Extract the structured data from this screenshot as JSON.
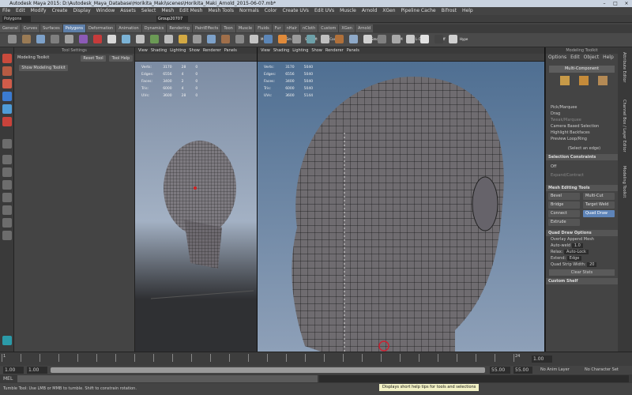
{
  "title": "Autodesk Maya 2015: D:\\Autodesk_Maya_Database\\Horikita_Maki\\scenes\\Horikita_Maki_Arnold_2015-06-07.mb*",
  "window_controls": [
    "–",
    "□",
    "×"
  ],
  "menus": [
    "File",
    "Edit",
    "Modify",
    "Create",
    "Display",
    "Window",
    "Assets",
    "Select",
    "Mesh",
    "Edit Mesh",
    "Mesh Tools",
    "Normals",
    "Color",
    "Create UVs",
    "Edit UVs",
    "Muscle",
    "Arnold",
    "XGen",
    "Pipeline Cache",
    "Bifrost",
    "Help"
  ],
  "status": {
    "mode": "Polygons",
    "selection_field": "Group20707"
  },
  "shelf_tabs": [
    "General",
    "Curves",
    "Surfaces",
    "Polygons",
    "Deformation",
    "Animation",
    "Dynamics",
    "Rendering",
    "PaintEffects",
    "Toon",
    "Muscle",
    "Fluids",
    "Fur",
    "nHair",
    "nCloth",
    "Custom",
    "XGen",
    "Arnold"
  ],
  "active_shelf_tab": "Polygons",
  "shelf_labels": [
    "M-Dm",
    "N-Sm",
    "Sm-Soft",
    "+Coord",
    "Pol-Fl",
    "Smos",
    "Del-M",
    "L-Off",
    "L-Off",
    "Hype"
  ],
  "tool_settings": {
    "header": "Tool Settings",
    "tool_name": "Modeling Toolkit",
    "reset_btn": "Reset Tool",
    "help_btn": "Tool Help",
    "show_btn": "Show Modeling Toolkit"
  },
  "viewport_menu": [
    "View",
    "Shading",
    "Lighting",
    "Show",
    "Renderer",
    "Panels"
  ],
  "stats_rows": [
    {
      "label": "Verts:",
      "a": "3170",
      "b": "28",
      "c": "0"
    },
    {
      "label": "Edges:",
      "a": "6556",
      "b": "4",
      "c": "0"
    },
    {
      "label": "Faces:",
      "a": "3400",
      "b": "2",
      "c": "0"
    },
    {
      "label": "Tris:",
      "a": "6000",
      "b": "4",
      "c": "0"
    },
    {
      "label": "UVs:",
      "a": "3600",
      "b": "28",
      "c": "0"
    }
  ],
  "stats_rows_right": [
    {
      "label": "Verts:",
      "a": "3170",
      "b": "5040"
    },
    {
      "label": "Edges:",
      "a": "6556",
      "b": "5040"
    },
    {
      "label": "Faces:",
      "a": "3400",
      "b": "5040"
    },
    {
      "label": "Tris:",
      "a": "6000",
      "b": "5040"
    },
    {
      "label": "UVs:",
      "a": "3600",
      "b": "5144"
    }
  ],
  "right_panel": {
    "header": "Modeling Toolkit",
    "menu": [
      "Options",
      "Edit",
      "Object",
      "Help"
    ],
    "multi_component": "Multi-Component",
    "pick_marquee": "Pick/Marquee",
    "drag": "Drag",
    "tweak": "Tweak/Marquee",
    "camera_sel": "Camera Based Selection",
    "highlight": "Highlight Backfaces",
    "preview": "Preview Loop/Ring",
    "select_edge": "(Select an edge)",
    "selection_constraints": "Selection Constraints",
    "off": "Off",
    "expand": "Expand/Contract",
    "tools_header": "Mesh Editing Tools",
    "tools": [
      "Bevel",
      "Multi-Cut",
      "Bridge",
      "Target Weld",
      "Connect",
      "Quad Draw",
      "Extrude"
    ],
    "active_tool": "Quad Draw",
    "quad_header": "Quad Draw Options",
    "overlay": "Overlay Append Mesh",
    "autoweld": "Auto-weld",
    "autoweld_val": "1.0",
    "relax": "Relax:",
    "relax_val": "Auto-Lock",
    "extend": "Extend:",
    "extend_val": "Edge",
    "strip": "Quad Strip Width:",
    "strip_val": "20",
    "clear": "Clear Stats",
    "custom": "Custom Shelf"
  },
  "right_strip": [
    "Attribute Editor",
    "Channel Box / Layer Editor",
    "Modeling Toolkit"
  ],
  "timeline": {
    "ticks": [
      "1",
      "",
      "",
      "",
      "",
      "",
      "",
      "",
      "",
      "",
      "",
      "",
      "",
      "",
      "",
      "",
      "",
      "",
      "",
      "",
      "",
      "",
      "",
      "",
      "",
      "",
      "",
      "24"
    ],
    "current": "1.00"
  },
  "range": {
    "start": "1.00",
    "inner_start": "1.00",
    "inner_end": "55.00",
    "end": "55.00",
    "anim_layer": "No Anim Layer",
    "char_set": "No Character Set",
    "frame_field": "1"
  },
  "cmd": {
    "label": "MEL"
  },
  "help": {
    "left": "Tumble Tool: Use LMB or MMB to tumble. Shift to constrain rotation.",
    "tooltip": "Displays short help tips for tools and selections"
  }
}
